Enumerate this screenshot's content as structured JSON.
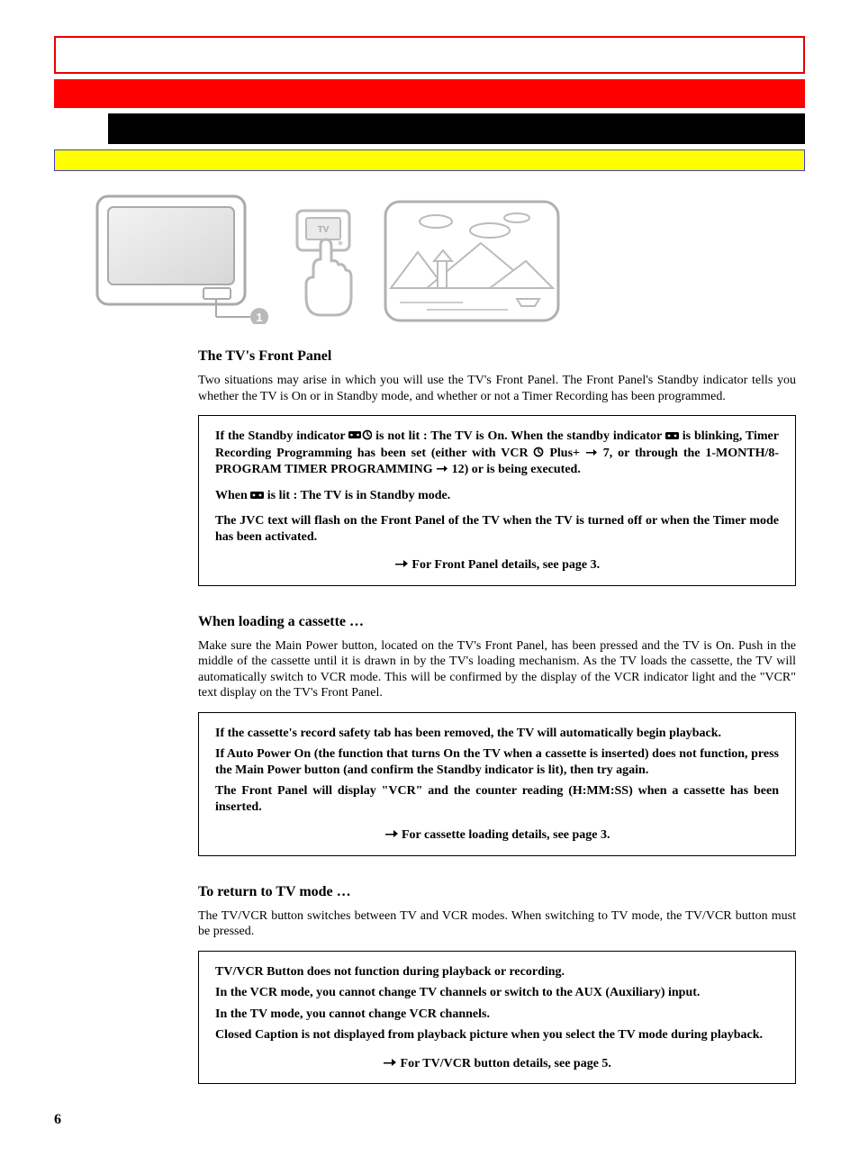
{
  "figure": {
    "tv_button_label": "TV",
    "marker_label": "1"
  },
  "section1": {
    "title": "The TV's Front Panel",
    "body": "Two situations may arise in which you will use the TV's  Front  Panel.  The Front Panel's   Standby indicator tells you whether the TV is On or in Standby mode, and whether or not a Timer Recording has been programmed."
  },
  "option_box_1": {
    "text_1a": "If the Standby indicator ",
    "text_1b": " is not lit :  The TV is On.  When the standby  indicator ",
    "text_1c": " is blinking, Timer Recording Programming has been set (either with VCR",
    "text_1d": " Plus+ ",
    "text_2a": "   7, or through the 1-MONTH/8-PROGRAM TIMER PROGRAMMING ",
    "text_2b": "   12) or is being executed.",
    "text_3a": "When  ",
    "text_3b": " is lit : ",
    "text_3c": " The  TV is in Standby mode.",
    "text_4": "The JVC text will flash on the Front Panel of  the TV when the TV  is turned off or when the Timer mode has been activated.",
    "ref_text": "For Front Panel details, see page 3."
  },
  "section2": {
    "title": "When loading a cassette …",
    "body": "Make sure the Main Power button, located on the TV's Front Panel, has been pressed and the TV is On.  Push in the middle of the cassette until it is drawn in by the TV's loading mechanism.  As the TV loads the cassette, the TV will automatically switch to VCR  mode.   This will be confirmed by the display  of the VCR indicator light  and the \"VCR\" text display on the TV's Front Panel."
  },
  "option_box_2": {
    "line1": "If the cassette's record safety tab has been removed, the TV will automatically begin playback.",
    "line2": "If Auto Power On (the function that turns On the TV when a cassette is inserted) does not function, press the Main Power button (and confirm the Standby indicator is lit), then try again.",
    "line3": "The Front Panel will display \"VCR\" and the counter reading (H:MM:SS) when  a  cassette has been inserted.",
    "ref_text": "For cassette loading details, see page 3."
  },
  "section3": {
    "title": "To return to TV mode …",
    "body": "The TV/VCR button switches between TV and VCR modes.  When switching to TV mode,  the TV/VCR button must be pressed."
  },
  "option_box_3": {
    "line1": "TV/VCR Button does not function during  playback or recording.",
    "line2": "In the VCR mode, you cannot change TV channels or switch to the AUX (Auxiliary)  input.",
    "line3": "In the TV mode, you cannot change VCR channels.",
    "line4": "Closed  Caption  is not displayed from playback  picture when you select the TV  mode during  playback.",
    "ref_text": "For TV/VCR button details, see page 5."
  },
  "page_number": "6"
}
